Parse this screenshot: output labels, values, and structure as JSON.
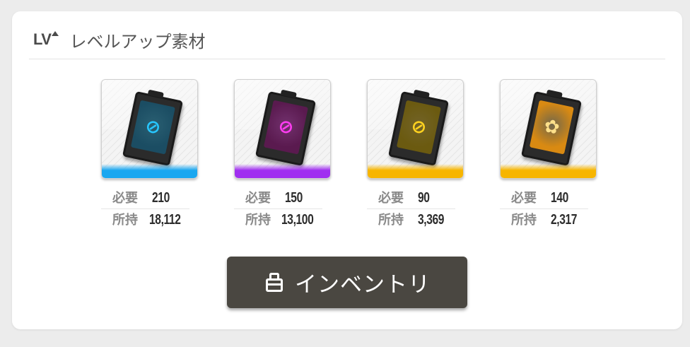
{
  "header": {
    "lv_label": "LV",
    "title": "レベルアップ素材"
  },
  "items": [
    {
      "color": "#1ea7e8",
      "stripe": "#1aa7f0",
      "screen": "#1b4d63",
      "glyph_color": "#27c6ff",
      "glyph": "⊘",
      "icon": "blue-level-up-device-icon",
      "required_label": "必要",
      "required": "210",
      "owned_label": "所持",
      "owned": "18,112"
    },
    {
      "color": "#b43ae0",
      "stripe": "#a02ff0",
      "screen": "#5a1a4f",
      "glyph_color": "#ff3df2",
      "glyph": "⊘",
      "icon": "purple-level-up-device-icon",
      "required_label": "必要",
      "required": "150",
      "owned_label": "所持",
      "owned": "13,100"
    },
    {
      "color": "#f2b40f",
      "stripe": "#f7b500",
      "screen": "#6b5a10",
      "glyph_color": "#ffd21f",
      "glyph": "⊘",
      "icon": "gold-level-up-device-icon",
      "required_label": "必要",
      "required": "90",
      "owned_label": "所持",
      "owned": "3,369"
    },
    {
      "color": "#f2a10f",
      "stripe": "#f7b500",
      "screen": "#d98a12",
      "glyph_color": "#ffe08a",
      "glyph": "✿",
      "icon": "orange-level-up-device-icon",
      "required_label": "必要",
      "required": "140",
      "owned_label": "所持",
      "owned": "2,317"
    }
  ],
  "inventory_button": {
    "label": "インベントリ",
    "icon": "backpack-icon"
  }
}
